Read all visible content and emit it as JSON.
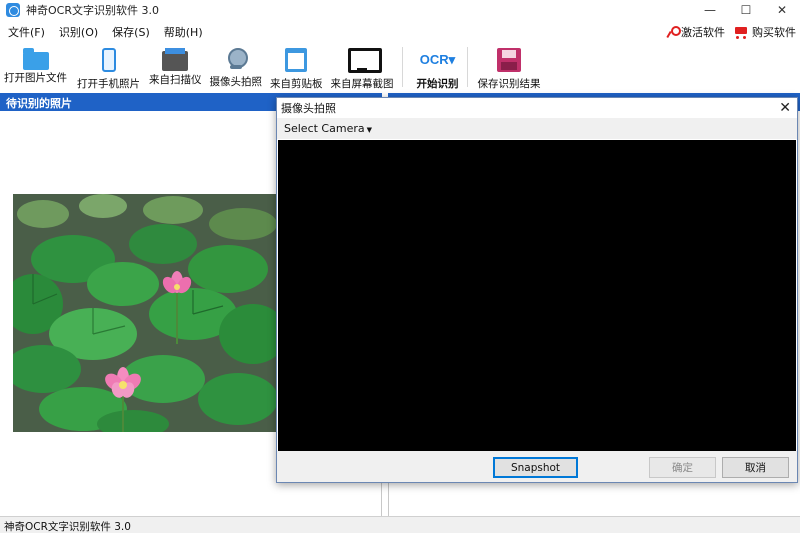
{
  "window": {
    "title": "神奇OCR文字识别软件 3.0",
    "minimize": "—",
    "maximize": "☐",
    "close": "✕"
  },
  "menu": {
    "items": [
      "文件(F)",
      "识别(O)",
      "保存(S)",
      "帮助(H)"
    ],
    "activate_label": "激活软件",
    "buy_label": "购买软件"
  },
  "toolbar": {
    "buttons": [
      {
        "label": "打开图片文件",
        "icon": "folder-icon"
      },
      {
        "label": "打开手机照片",
        "icon": "phone-icon"
      },
      {
        "label": "来自扫描仪",
        "icon": "scanner-icon"
      },
      {
        "label": "摄像头拍照",
        "icon": "webcam-icon"
      },
      {
        "label": "来自剪贴板",
        "icon": "clipboard-icon"
      },
      {
        "label": "来自屏幕截图",
        "icon": "monitor-icon"
      },
      {
        "label": "开始识别",
        "icon": "ocr-icon",
        "icon_text": "OCR▾"
      },
      {
        "label": "保存识别结果",
        "icon": "save-icon"
      }
    ]
  },
  "left_panel": {
    "title": "待识别的照片"
  },
  "status_bar": {
    "text": "神奇OCR文字识别软件 3.0"
  },
  "dialog": {
    "title": "摄像头拍照",
    "close": "✕",
    "select_camera": "Select Camera",
    "snapshot": "Snapshot",
    "ok": "确定",
    "cancel": "取消"
  },
  "colors": {
    "panel_header": "#1f62c6",
    "video_bg": "#000000"
  }
}
